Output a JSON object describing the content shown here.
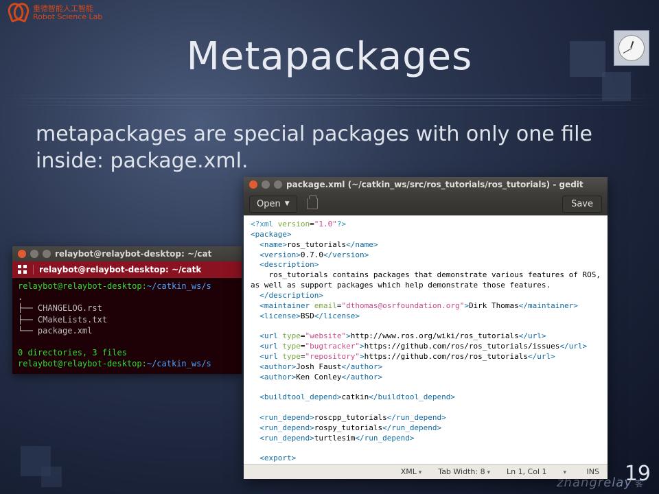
{
  "slide": {
    "title": "Metapackages",
    "body": "metapackages are special packages with only one file inside: package.xml.",
    "page_number": "19",
    "watermark": "zhangrelay",
    "watermark_suffix": "客"
  },
  "logo": {
    "line1": "重德智能人工智能",
    "line2": "Robot Science Lab"
  },
  "terminal": {
    "window_title": "relaybot@relaybot-desktop: ~/cat",
    "tab_title": "relaybot@relaybot-desktop: ~/catk",
    "prompt1_user": "relaybot@relaybot-desktop",
    "prompt1_path": "~/catkin_ws/s",
    "tree_lines": [
      "├── CHANGELOG.rst",
      "├── CMakeLists.txt",
      "└── package.xml"
    ],
    "summary": "0 directories, 3 files",
    "prompt2_user": "relaybot@relaybot-desktop",
    "prompt2_path": "~/catkin_ws/s"
  },
  "gedit": {
    "window_title": "package.xml (~/catkin_ws/src/ros_tutorials/ros_tutorials) - gedit",
    "open_label": "Open",
    "save_label": "Save",
    "status": {
      "lang": "XML",
      "tabwidth": "Tab Width: 8",
      "position": "Ln 1, Col 1",
      "insert": "INS"
    },
    "xml": {
      "decl": "<?xml version=\"1.0\"?>",
      "name": "ros_tutorials",
      "version": "0.7.0",
      "description": "ros_tutorials contains packages that demonstrate various features of ROS, as well as support packages which help demonstrate those features.",
      "maintainer_email": "dthomas@osrfoundation.org",
      "maintainer_name": "Dirk Thomas",
      "license": "BSD",
      "url_website": "http://www.ros.org/wiki/ros_tutorials",
      "url_bugtracker": "https://github.com/ros/ros_tutorials/issues",
      "url_repository": "https://github.com/ros/ros_tutorials",
      "author1": "Josh Faust",
      "author2": "Ken Conley",
      "buildtool_depend": "catkin",
      "run_depend1": "roscpp_tutorials",
      "run_depend2": "rospy_tutorials",
      "run_depend3": "turtlesim"
    }
  }
}
